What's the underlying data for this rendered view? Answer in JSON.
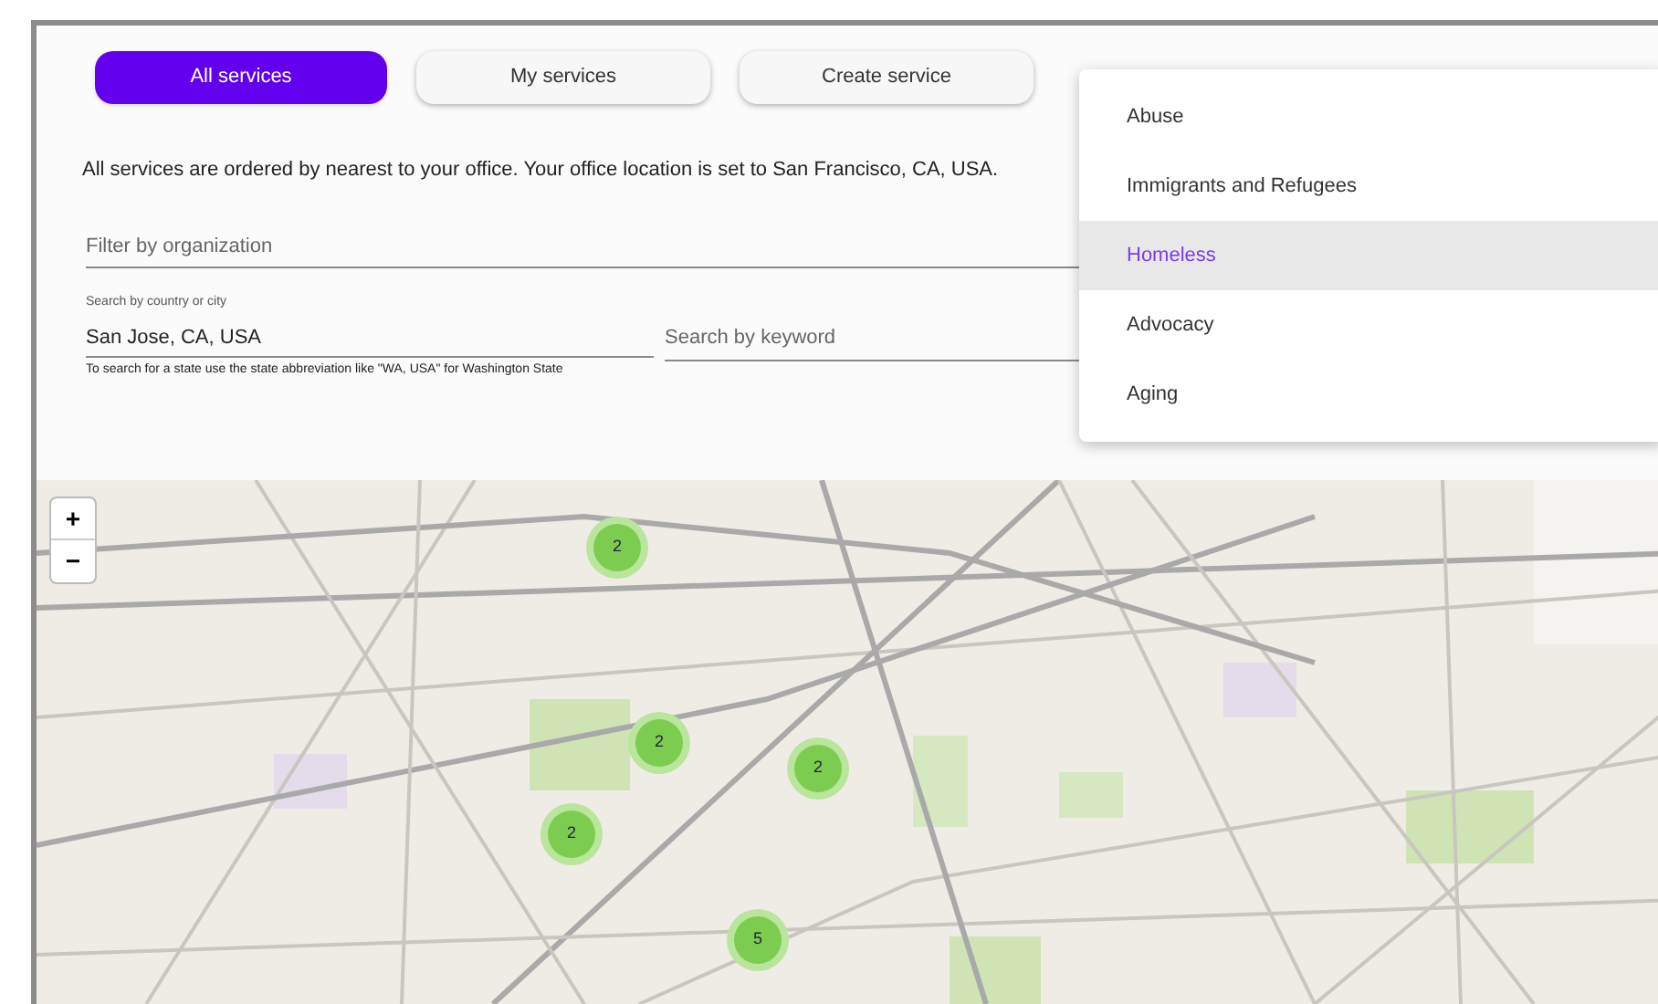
{
  "tabs": [
    {
      "label": "All services",
      "selected": true
    },
    {
      "label": "My services",
      "selected": false
    },
    {
      "label": "Create service",
      "selected": false
    }
  ],
  "notice": "All services are ordered by nearest to your office. Your office location is set to San Francisco, CA, USA.",
  "filters": {
    "organization": {
      "placeholder": "Filter by organization"
    },
    "location": {
      "label": "Search by country or city",
      "value": "San Jose, CA, USA",
      "helper": "To search for a state use the state abbreviation like \"WA, USA\" for Washington State"
    },
    "keyword": {
      "placeholder": "Search by keyword"
    }
  },
  "category_menu": [
    {
      "label": "Abuse",
      "selected": false
    },
    {
      "label": "Immigrants and Refugees",
      "selected": false
    },
    {
      "label": "Homeless",
      "selected": true
    },
    {
      "label": "Advocacy",
      "selected": false
    },
    {
      "label": "Aging",
      "selected": false
    }
  ],
  "map": {
    "kind": "picture",
    "zoom_in": "+",
    "zoom_out": "−",
    "clusters": [
      {
        "count": "2"
      },
      {
        "count": "2"
      },
      {
        "count": "2"
      },
      {
        "count": "2"
      },
      {
        "count": "5"
      }
    ]
  }
}
